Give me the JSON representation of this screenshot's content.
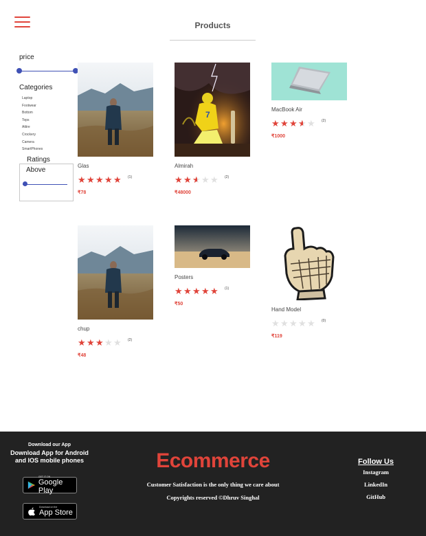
{
  "header": {
    "title": "Products"
  },
  "filters": {
    "price_label": "price",
    "price_range": [
      0,
      25000
    ],
    "categories_title": "Categories",
    "categories": [
      "Laptop",
      "Footwear",
      "Bottom",
      "Tops",
      "Attire",
      "Crockery",
      "Camera",
      "SmartPhones"
    ],
    "ratings_label": "Ratings",
    "ratings_above_label": "Above",
    "ratings_value": 0
  },
  "products": [
    {
      "name": "Glas",
      "rating": 5,
      "reviews": "(1)",
      "price": "₹78",
      "image": "man-in-field-photo"
    },
    {
      "name": "Almirah",
      "rating": 2.5,
      "reviews": "(2)",
      "price": "₹48000",
      "image": "cricketer-poster-photo"
    },
    {
      "name": "MacBook Air",
      "rating": 3.5,
      "reviews": "(2)",
      "price": "₹1000",
      "image": "laptop-photo"
    },
    {
      "name": "chup",
      "rating": 3,
      "reviews": "(2)",
      "price": "₹48",
      "image": "man-in-field-photo"
    },
    {
      "name": "Posters",
      "rating": 5,
      "reviews": "(1)",
      "price": "₹50",
      "image": "car-on-beach-photo"
    },
    {
      "name": "Hand Model",
      "rating": 0,
      "reviews": "(0)",
      "price": "₹119",
      "image": "armored-hand-illustration"
    }
  ],
  "footer": {
    "download_heading": "Download our App",
    "download_desc": "Download App for Android and IOS mobile phones",
    "google_play_sub": "GET IT ON",
    "google_play_main": "Google Play",
    "app_store_sub": "Download on the",
    "app_store_main": "App Store",
    "brand": "Ecommerce",
    "tagline": "Customer Satisfaction is the only thing we care about",
    "copyright": "Copyrights reserved ©Dhruv Singhal",
    "follow_heading": "Follow Us",
    "links": [
      "Instagram",
      "LinkedIn",
      "GitHub"
    ]
  },
  "colors": {
    "accent": "#e0443a",
    "slider": "#3f51b5",
    "footer_bg": "#222222"
  },
  "icons": {
    "menu": "hamburger-menu-icon",
    "star": "star-icon",
    "play": "google-play-icon",
    "apple": "apple-icon"
  }
}
